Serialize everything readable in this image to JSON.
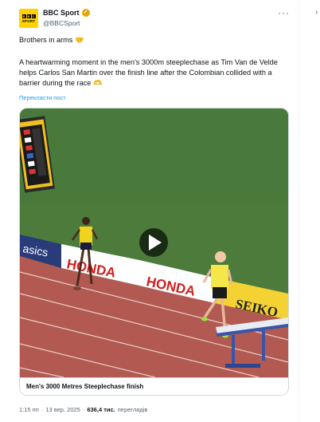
{
  "author": {
    "display_name": "BBC Sport",
    "handle": "@BBCSport",
    "avatar": {
      "top_left": "B",
      "middle": "B",
      "right": "C",
      "sub": "SPORT"
    },
    "verified_color": "#e2a700"
  },
  "post": {
    "line1": "Brothers in arms 🤝",
    "line2": "A heartwarming moment in the men's 3000m steeplechase as Tim Van de Velde helps Carlos San Martin over the finish line after the Colombian collided with a barrier during the race 🫶",
    "translate_link": "Перекласти пост"
  },
  "media": {
    "caption": "Men's 3000 Metres Steeplechase finish",
    "board_left": "HONDA",
    "board_right": "HONDA",
    "board_seiko": "SEIKO",
    "board_asics": "asics",
    "play_icon": "play-icon"
  },
  "meta": {
    "time": "1:15 пп",
    "sep": "·",
    "date": "13 вер. 2025",
    "sep2": "·",
    "views": "636,4 тис.",
    "views_label": "переглядів"
  },
  "menu_icon": "more-horizontal-icon",
  "colors": {
    "accent": "#1d9bf0",
    "track": "#b25a52",
    "infield": "#4a7a3a"
  }
}
